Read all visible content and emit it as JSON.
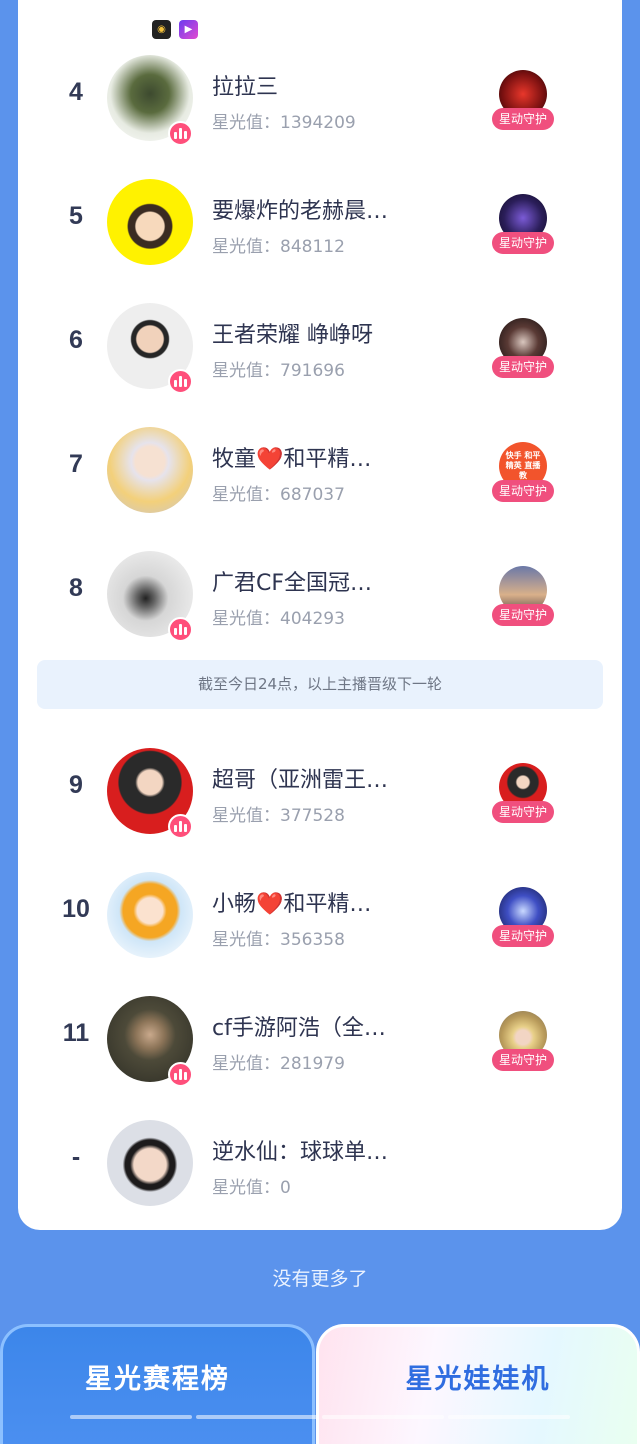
{
  "accent_colors": {
    "background": "#5b93ec",
    "guard_tag": "#f04f7e",
    "live_badge": "#ff4f7b"
  },
  "top_icons": [
    {
      "icon": "yellow-circle-app-icon",
      "text": "◉"
    },
    {
      "icon": "purple-play-app-icon",
      "text": "▶"
    }
  ],
  "rows": [
    {
      "rank": "4",
      "name": "拉拉三",
      "score_label": "星光值：",
      "score": "1394209",
      "live": true,
      "guard_label": "星动守护",
      "avatar_icon": "ink-painting-avatar",
      "guard_icon": "red-logo-avatar"
    },
    {
      "rank": "5",
      "name": "要爆炸的老赫晨…",
      "score_label": "星光值：",
      "score": "848112",
      "live": false,
      "guard_label": "星动守护",
      "avatar_icon": "cartoon-boy-yellow-avatar",
      "guard_icon": "anime-dark-avatar"
    },
    {
      "rank": "6",
      "name": "王者荣耀 峥峥呀",
      "score_label": "星光值：",
      "score": "791696",
      "live": true,
      "guard_label": "星动守护",
      "avatar_icon": "cartoon-man-avatar",
      "guard_icon": "dark-photo-avatar"
    },
    {
      "rank": "7",
      "name_prefix": "牧童",
      "name_heart": "❤️",
      "name_suffix": "和平精…",
      "score_label": "星光值：",
      "score": "687037",
      "live": false,
      "guard_label": "星动守护",
      "guard_avatar_text": "快手 和平精英 直播教",
      "avatar_icon": "anime-white-hair-avatar",
      "guard_icon": "orange-text-avatar"
    },
    {
      "rank": "8",
      "name": "广君CF全国冠…",
      "score_label": "星光值：",
      "score": "404293",
      "live": true,
      "guard_label": "星动守护",
      "avatar_icon": "calligraphy-avatar",
      "guard_icon": "sunset-avatar"
    },
    {
      "rank": "9",
      "name": "超哥（亚洲雷王…",
      "score_label": "星光值：",
      "score": "377528",
      "live": true,
      "guard_label": "星动守护",
      "avatar_icon": "soldier-cartoon-avatar",
      "guard_icon": "red-cartoon-avatar"
    },
    {
      "rank": "10",
      "name_prefix": "小畅",
      "name_heart": "❤️",
      "name_suffix": "和平精…",
      "score_label": "星光值：",
      "score": "356358",
      "live": false,
      "guard_label": "星动守护",
      "avatar_icon": "anime-orange-hair-avatar",
      "guard_icon": "anime-blue-avatar"
    },
    {
      "rank": "11",
      "name": "cf手游阿浩（全…",
      "score_label": "星光值：",
      "score": "281979",
      "live": true,
      "guard_label": "星动守护",
      "avatar_icon": "soldier-photo-avatar",
      "guard_icon": "blonde-photo-avatar"
    },
    {
      "rank": "-",
      "name": "逆水仙：球球单…",
      "score_label": "星光值：",
      "score": "0",
      "live": false,
      "guard_label": "",
      "avatar_icon": "young-man-photo-avatar",
      "guard_icon": ""
    }
  ],
  "notice": "截至今日24点，以上主播晋级下一轮",
  "no_more": "没有更多了",
  "tabs": {
    "left": "星光赛程榜",
    "right": "星光娃娃机"
  }
}
